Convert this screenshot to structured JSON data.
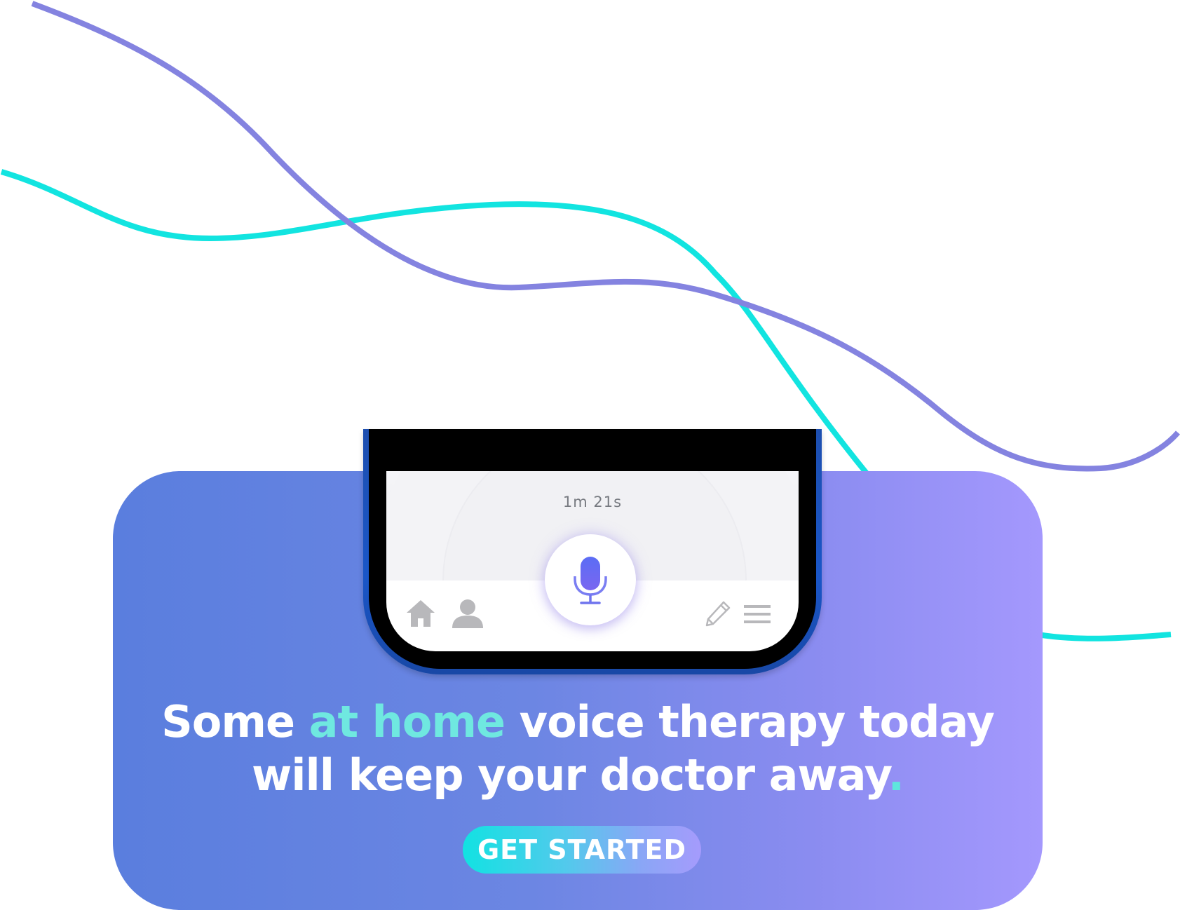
{
  "colors": {
    "purple_wave": "#8483e0",
    "cyan_wave": "#12e4e0",
    "card_gradient_start": "#5a7ede",
    "card_gradient_end": "#a498fd",
    "accent_text": "#6fe8e0",
    "button_gradient_start": "#12e2e2",
    "button_gradient_end": "#a59bfc"
  },
  "phone": {
    "timer": "1m 21s",
    "nav_icons": [
      "home-icon",
      "user-icon",
      "microphone-icon",
      "pencil-icon",
      "menu-icon"
    ]
  },
  "headline": {
    "part1": "Some ",
    "accent": "at home",
    "part2": " voice therapy today",
    "line2": "will keep your doctor away",
    "dot": "."
  },
  "cta": {
    "label": "GET STARTED"
  }
}
